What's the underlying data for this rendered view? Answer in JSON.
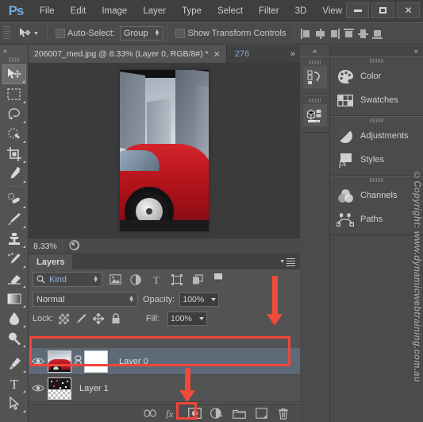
{
  "app": {
    "logo": "Ps",
    "menu": [
      "File",
      "Edit",
      "Image",
      "Layer",
      "Type",
      "Select",
      "Filter",
      "3D",
      "View"
    ],
    "window_controls": {
      "minimize": "minimize-icon",
      "maximize": "maximize-icon",
      "close": "✕"
    }
  },
  "options_bar": {
    "tool_icon": "move-tool-icon",
    "auto_select_label": "Auto-Select:",
    "auto_select_checked": false,
    "group_value": "Group",
    "show_transform_label": "Show Transform Controls",
    "show_transform_checked": false,
    "align_icons": [
      "align-left-edges-icon",
      "align-horizontal-centers-icon",
      "align-right-edges-icon",
      "align-top-edges-icon",
      "align-vertical-centers-icon",
      "align-bottom-edges-icon"
    ]
  },
  "toolbar": {
    "collapse_icon": "»",
    "tools": [
      {
        "name": "move-tool",
        "selected": true,
        "has_flyout": true
      },
      {
        "name": "rectangular-marquee-tool",
        "selected": false,
        "has_flyout": true
      },
      {
        "name": "lasso-tool",
        "selected": false,
        "has_flyout": true
      },
      {
        "name": "quick-selection-tool",
        "selected": false,
        "has_flyout": true
      },
      {
        "name": "crop-tool",
        "selected": false,
        "has_flyout": true
      },
      {
        "name": "eyedropper-tool",
        "selected": false,
        "has_flyout": true
      },
      {
        "name": "spot-healing-brush-tool",
        "selected": false,
        "has_flyout": true
      },
      {
        "name": "brush-tool",
        "selected": false,
        "has_flyout": true
      },
      {
        "name": "clone-stamp-tool",
        "selected": false,
        "has_flyout": true
      },
      {
        "name": "history-brush-tool",
        "selected": false,
        "has_flyout": true
      },
      {
        "name": "eraser-tool",
        "selected": false,
        "has_flyout": true
      },
      {
        "name": "gradient-tool",
        "selected": false,
        "has_flyout": true
      },
      {
        "name": "blur-tool",
        "selected": false,
        "has_flyout": true
      },
      {
        "name": "dodge-tool",
        "selected": false,
        "has_flyout": true
      },
      {
        "name": "pen-tool",
        "selected": false,
        "has_flyout": true
      },
      {
        "name": "horizontal-type-tool",
        "selected": false,
        "has_flyout": true
      },
      {
        "name": "path-selection-tool",
        "selected": false,
        "has_flyout": true
      }
    ]
  },
  "document": {
    "tab_title": "206007_med.jpg @ 8.33% (Layer 0, RGB/8#) *",
    "tab_close": "✕",
    "second_tab": "276",
    "overflow": "»",
    "status_zoom": "8.33%",
    "status_icon": "document-thumb-icon"
  },
  "layers_panel": {
    "tab_label": "Layers",
    "menu_icon": "panel-menu-icon",
    "filter": {
      "search_icon": "search-icon",
      "kind_label": "Kind",
      "type_icons": [
        "filter-pixel-layers-icon",
        "filter-adjustment-layers-icon",
        "filter-type-layers-icon",
        "filter-shape-layers-icon",
        "filter-smart-object-icon",
        "filter-toggle-icon"
      ]
    },
    "blend_mode": "Normal",
    "opacity_label": "Opacity:",
    "opacity_value": "100%",
    "lock_label": "Lock:",
    "lock_icons": [
      "lock-transparent-pixels-icon",
      "lock-image-pixels-icon",
      "lock-position-icon",
      "lock-all-icon"
    ],
    "fill_label": "Fill:",
    "fill_value": "100%",
    "layers": [
      {
        "name": "Layer 0",
        "visible": true,
        "selected": true,
        "has_mask": true,
        "linked": true,
        "thumbnail": "red-car-thumbnail",
        "mask_thumbnail": "white-layer-mask"
      },
      {
        "name": "Layer 1",
        "visible": true,
        "selected": false,
        "has_mask": false,
        "linked": false,
        "thumbnail": "dark-sparkle-thumbnail"
      }
    ],
    "bottom_buttons": [
      {
        "name": "link-layers-button",
        "icon": "link-icon",
        "highlighted": false
      },
      {
        "name": "add-layer-style-button",
        "icon": "fx-icon",
        "highlighted": false
      },
      {
        "name": "add-layer-mask-button",
        "icon": "layer-mask-icon",
        "highlighted": true
      },
      {
        "name": "new-fill-adjustment-layer-button",
        "icon": "half-circle-icon",
        "highlighted": false
      },
      {
        "name": "new-group-button",
        "icon": "folder-icon",
        "highlighted": false
      },
      {
        "name": "new-layer-button",
        "icon": "new-layer-icon",
        "highlighted": false
      },
      {
        "name": "delete-layer-button",
        "icon": "trash-icon",
        "highlighted": false
      }
    ]
  },
  "icon_dock": {
    "collapse_icon": "«",
    "buttons": [
      {
        "name": "history-panel-icon"
      },
      {
        "name": "mini-bridge-panel-icon"
      }
    ]
  },
  "right_panel": {
    "collapse_icon": "«",
    "groups": [
      {
        "items": [
          {
            "label": "Color",
            "icon": "color-palette-icon"
          },
          {
            "label": "Swatches",
            "icon": "swatches-grid-icon"
          }
        ]
      },
      {
        "items": [
          {
            "label": "Adjustments",
            "icon": "adjustments-circle-icon"
          },
          {
            "label": "Styles",
            "icon": "styles-fx-icon"
          }
        ]
      },
      {
        "items": [
          {
            "label": "Channels",
            "icon": "channels-venn-icon"
          },
          {
            "label": "Paths",
            "icon": "paths-pen-icon"
          }
        ]
      }
    ]
  },
  "annotations": {
    "color": "#f0453a",
    "highlight_rect_target": "Layer 0 row",
    "highlight_rect2_target": "Add layer mask button",
    "arrow1": "arrow-pointing-to-layer-0",
    "arrow2": "arrow-pointing-to-add-layer-mask"
  },
  "watermark": {
    "text": "©Copyright: www.dynamicwebtraining.com.au"
  },
  "colors": {
    "chrome_bg": "#535353",
    "panel_bg": "#4b4b4b",
    "titlebar_bg": "#3f3f3f",
    "accent_blue": "#6fa8dc",
    "annotation_red": "#f0453a",
    "selected_layer": "#5f6a78"
  }
}
